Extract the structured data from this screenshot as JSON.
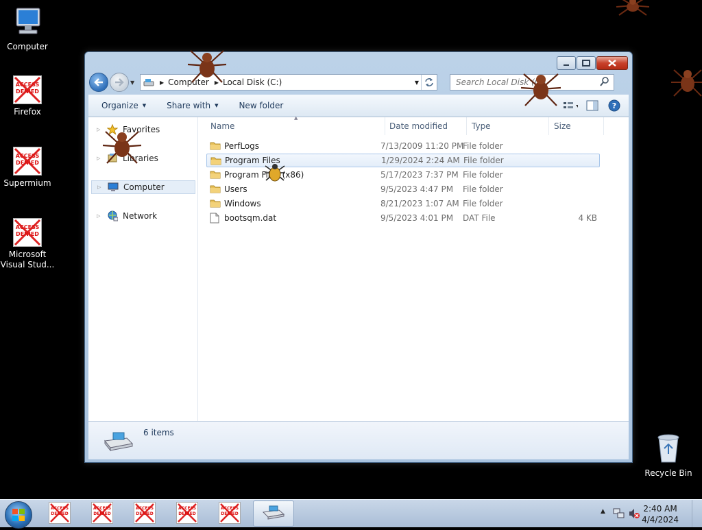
{
  "desktop": {
    "icons": [
      {
        "label": "Computer",
        "icon": "computer-icon"
      },
      {
        "label": "Firefox",
        "icon": "access-denied-icon"
      },
      {
        "label": "Supermium",
        "icon": "access-denied-icon"
      },
      {
        "label": "Microsoft Visual Stud...",
        "icon": "access-denied-icon"
      },
      {
        "label": "Recycle Bin",
        "icon": "recycle-bin-icon"
      }
    ],
    "denied_text": "ACCESS DENIED"
  },
  "window": {
    "breadcrumb": [
      "Computer",
      "Local Disk (C:)"
    ],
    "search_placeholder": "Search Local Disk (C:)",
    "toolbar": {
      "organize": "Organize",
      "share_with": "Share with",
      "new_folder": "New folder"
    },
    "nav": [
      {
        "label": "Favorites",
        "icon": "star-icon"
      },
      {
        "label": "Libraries",
        "icon": "libraries-icon"
      },
      {
        "label": "Computer",
        "icon": "computer-icon",
        "selected": true
      },
      {
        "label": "Network",
        "icon": "network-icon"
      }
    ],
    "columns": {
      "name": "Name",
      "date": "Date modified",
      "type": "Type",
      "size": "Size"
    },
    "files": [
      {
        "name": "PerfLogs",
        "date": "7/13/2009 11:20 PM",
        "type": "File folder",
        "size": "",
        "icon": "folder-icon"
      },
      {
        "name": "Program Files",
        "date": "1/29/2024 2:24 AM",
        "type": "File folder",
        "size": "",
        "icon": "folder-icon",
        "selected": true
      },
      {
        "name": "Program Files (x86)",
        "date": "5/17/2023 7:37 PM",
        "type": "File folder",
        "size": "",
        "icon": "folder-icon"
      },
      {
        "name": "Users",
        "date": "9/5/2023 4:47 PM",
        "type": "File folder",
        "size": "",
        "icon": "folder-icon"
      },
      {
        "name": "Windows",
        "date": "8/21/2023 1:07 AM",
        "type": "File folder",
        "size": "",
        "icon": "folder-icon"
      },
      {
        "name": "bootsqm.dat",
        "date": "9/5/2023 4:01 PM",
        "type": "DAT File",
        "size": "4 KB",
        "icon": "file-icon"
      }
    ],
    "status": {
      "count": "6 items"
    }
  },
  "taskbar": {
    "clock_time": "2:40 AM",
    "clock_date": "4/4/2024"
  },
  "colors": {
    "desktop": "#000000",
    "selection": "#cce0f7",
    "title_link": "#1e395b"
  }
}
